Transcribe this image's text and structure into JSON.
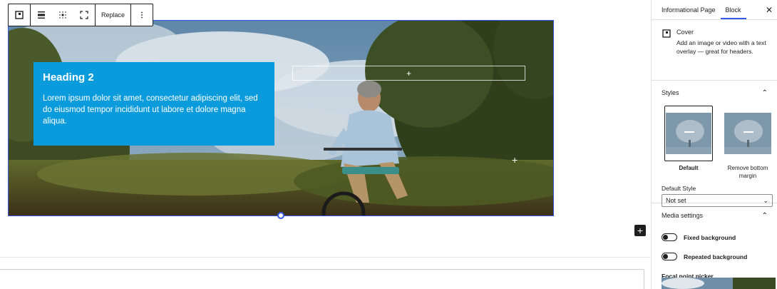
{
  "toolbar": {
    "replace_label": "Replace"
  },
  "cover": {
    "heading": "Heading 2",
    "paragraph": "Lorem ipsum dolor sit amet, consectetur adipiscing elit, sed do eiusmod tempor incididunt ut labore et dolore magna aliqua.",
    "plus_glyph": "+",
    "overlay_color": "#0a9bdd"
  },
  "canvas": {
    "inserter_glyph": "+"
  },
  "sidebar": {
    "tabs": [
      {
        "label": "Informational Page"
      },
      {
        "label": "Block"
      }
    ],
    "close_glyph": "✕",
    "block_name": "Cover",
    "block_description": "Add an image or video with a text overlay — great for headers.",
    "styles_title": "Styles",
    "styles": [
      {
        "label": "Default"
      },
      {
        "label": "Remove bottom margin"
      }
    ],
    "default_style_label": "Default Style",
    "default_style_value": "Not set",
    "media_title": "Media settings",
    "fixed_background_label": "Fixed background",
    "repeated_background_label": "Repeated background",
    "focal_point_label": "Focal point picker"
  },
  "colors": {
    "accent": "#3858e9",
    "overlay": "#0a9bdd"
  }
}
